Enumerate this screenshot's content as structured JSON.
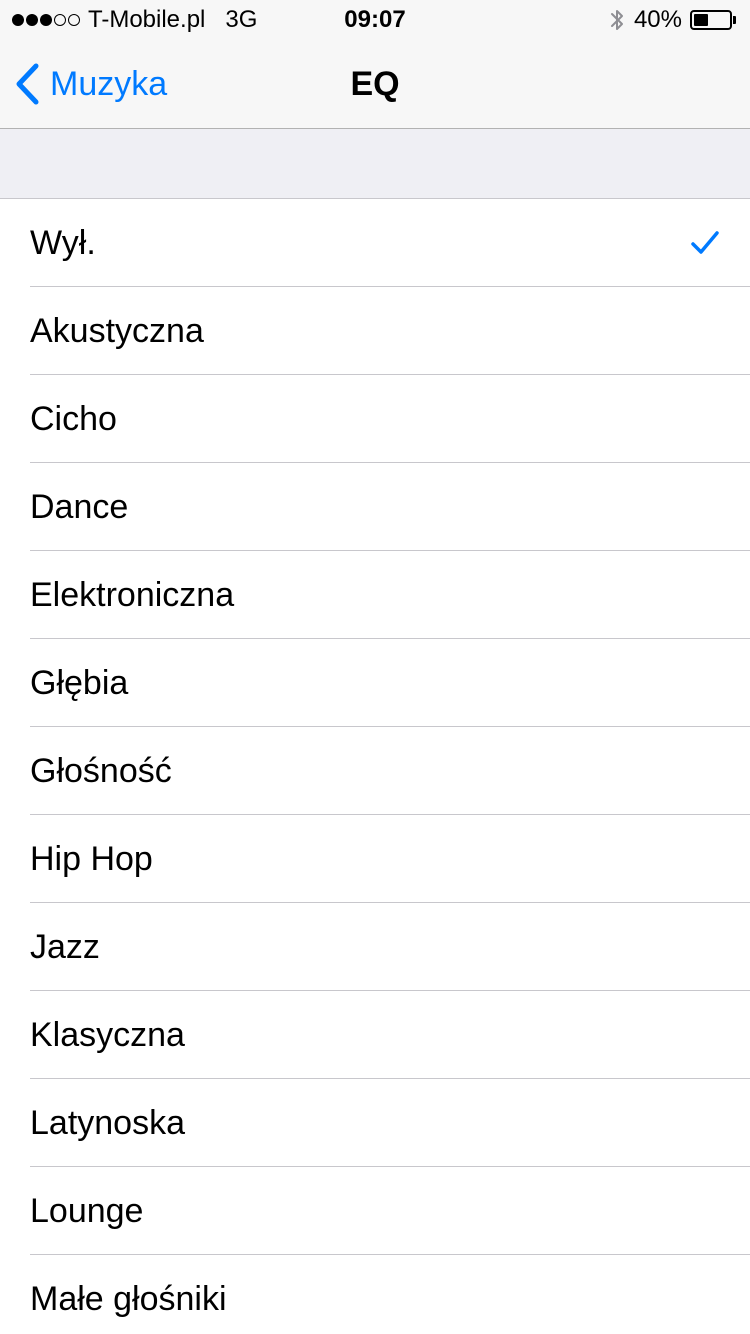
{
  "status_bar": {
    "signal_total": 5,
    "signal_filled": 3,
    "carrier": "T-Mobile.pl",
    "network": "3G",
    "time": "09:07",
    "bluetooth_icon": "bluetooth-icon",
    "battery_percent_label": "40%",
    "battery_level": 0.4
  },
  "nav": {
    "back_label": "Muzyka",
    "back_icon": "chevron-left-icon",
    "title": "EQ"
  },
  "colors": {
    "accent": "#007aff",
    "bar_background": "#f7f7f7",
    "group_background": "#efeff4",
    "separator": "#c8c7cc"
  },
  "eq_list": {
    "items": [
      {
        "label": "Wył.",
        "selected": true
      },
      {
        "label": "Akustyczna",
        "selected": false
      },
      {
        "label": "Cicho",
        "selected": false
      },
      {
        "label": "Dance",
        "selected": false
      },
      {
        "label": "Elektroniczna",
        "selected": false
      },
      {
        "label": "Głębia",
        "selected": false
      },
      {
        "label": "Głośność",
        "selected": false
      },
      {
        "label": "Hip Hop",
        "selected": false
      },
      {
        "label": "Jazz",
        "selected": false
      },
      {
        "label": "Klasyczna",
        "selected": false
      },
      {
        "label": "Latynoska",
        "selected": false
      },
      {
        "label": "Lounge",
        "selected": false
      },
      {
        "label": "Małe głośniki",
        "selected": false
      }
    ]
  }
}
